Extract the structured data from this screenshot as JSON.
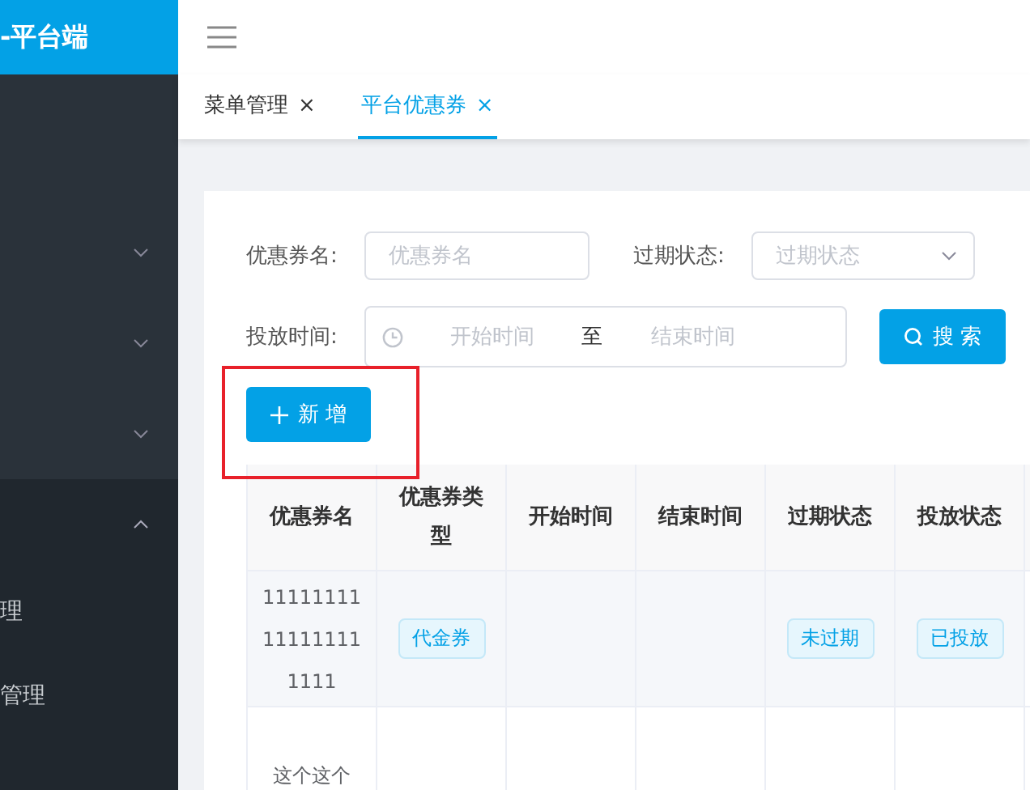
{
  "sidebar": {
    "logo": "-平台端",
    "menus": [
      {
        "kind": "group",
        "expanded": false
      },
      {
        "kind": "group",
        "expanded": false
      },
      {
        "kind": "group",
        "expanded": false
      },
      {
        "kind": "group",
        "expanded": true,
        "children": [
          {
            "label": "理"
          },
          {
            "label": "管理"
          }
        ]
      }
    ]
  },
  "tabs": [
    {
      "label": "菜单管理",
      "selected": false,
      "close": "×"
    },
    {
      "label": "平台优惠券",
      "selected": true,
      "close": "×"
    }
  ],
  "filters": {
    "name": {
      "label": "优惠券名:",
      "placeholder": "优惠券名"
    },
    "expiry": {
      "label": "过期状态:",
      "placeholder": "过期状态"
    },
    "time": {
      "label": "投放时间:",
      "start_placeholder": "开始时间",
      "separator": "至",
      "end_placeholder": "结束时间"
    },
    "search_button": "搜 索"
  },
  "add_button": "新 增",
  "table": {
    "columns": [
      "优惠券名",
      "优惠券类型",
      "开始时间",
      "结束时间",
      "过期状态",
      "投放状态"
    ],
    "rows": [
      [
        {
          "kind": "text",
          "text": "11111111 11111111 1111"
        },
        {
          "kind": "tag",
          "text": "代金券"
        },
        {
          "kind": "text",
          "text": ""
        },
        {
          "kind": "text",
          "text": ""
        },
        {
          "kind": "tag",
          "text": "未过期"
        },
        {
          "kind": "tag",
          "text": "已投放"
        }
      ],
      [
        {
          "kind": "text",
          "text": "这个这个"
        },
        {
          "kind": "text",
          "text": ""
        },
        {
          "kind": "text",
          "text": ""
        },
        {
          "kind": "text",
          "text": ""
        },
        {
          "kind": "text",
          "text": ""
        },
        {
          "kind": "text",
          "text": ""
        }
      ]
    ]
  }
}
